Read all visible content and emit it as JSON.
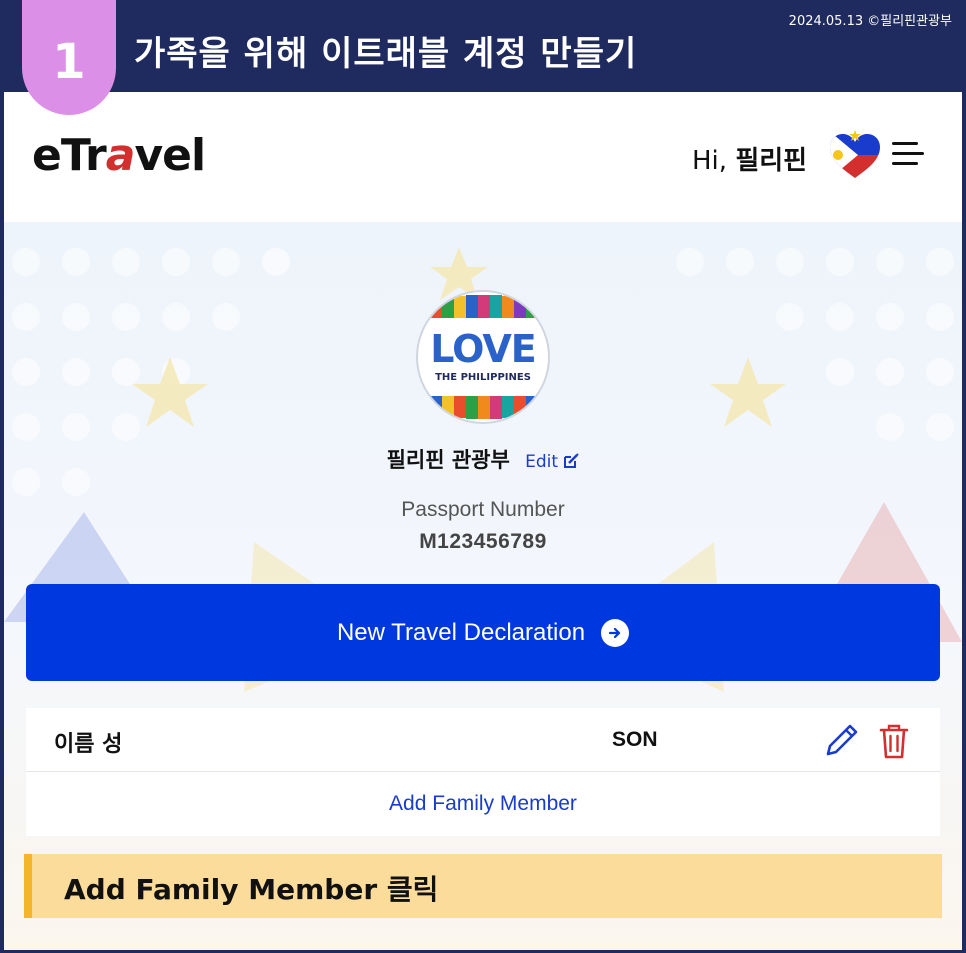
{
  "banner": {
    "step_number": "1",
    "title": "가족을 위해 이트래블 계정 만들기",
    "date_credit": "2024.05.13 ©필리핀관광부"
  },
  "header": {
    "logo": {
      "pre": "eTr",
      "accent": "a",
      "post": "vel"
    },
    "greeting_prefix": "Hi,",
    "greeting_name": "필리핀",
    "avatar_icon": "philippines-heart-flag-icon",
    "menu_icon": "hamburger-menu-icon"
  },
  "profile": {
    "logo_word": "LOVE",
    "logo_subtitle": "THE PHILIPPINES",
    "name": "필리핀 관광부",
    "edit_label": "Edit",
    "passport_label": "Passport Number",
    "passport_number": "M123456789"
  },
  "actions": {
    "new_declaration_label": "New Travel Declaration"
  },
  "family": {
    "members": [
      {
        "name": "이름 성",
        "surname": "SON"
      }
    ],
    "add_member_label": "Add Family Member"
  },
  "tip": {
    "text": "Add Family Member 클릭"
  },
  "colors": {
    "banner": "#1f2a5e",
    "badge": "#dc8fe6",
    "primary": "#0038e0",
    "link": "#1a3ccc",
    "delete": "#d32f2f",
    "tip_bg": "#fbdc9b",
    "tip_border": "#f3b52a"
  }
}
